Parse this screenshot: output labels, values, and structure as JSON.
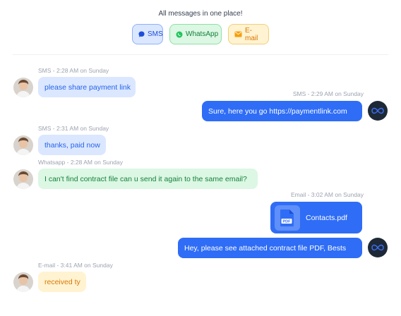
{
  "header": {
    "title": "All messages in one place!",
    "channels": [
      {
        "label": "SMS",
        "icon": "chat-bubble-icon",
        "color": "#1d4ed8"
      },
      {
        "label": "WhatsApp",
        "icon": "whatsapp-icon",
        "color": "#15803d"
      },
      {
        "label": "E-mail",
        "icon": "envelope-icon",
        "color": "#d97706"
      }
    ]
  },
  "messages": [
    {
      "direction": "incoming",
      "channel": "SMS",
      "meta": "SMS - 2:28 AM on Sunday",
      "text": "please share payment link"
    },
    {
      "direction": "outgoing",
      "channel": "SMS",
      "meta": "SMS - 2:29 AM on Sunday",
      "text": "Sure, here you go https://paymentlink.com"
    },
    {
      "direction": "incoming",
      "channel": "SMS",
      "meta": "SMS - 2:31 AM on Sunday",
      "text": "thanks, paid now"
    },
    {
      "direction": "incoming",
      "channel": "Whatsapp",
      "meta": "Whatsapp - 2:28 AM on Sunday",
      "text": "I can't find contract file can u send it again to the same email?"
    },
    {
      "direction": "outgoing",
      "channel": "Email",
      "meta": "Email - 3:02 AM on Sunday",
      "attachment": {
        "name": "Contacts.pdf",
        "icon": "pdf-file-icon",
        "icon_label": "PDF"
      }
    },
    {
      "direction": "outgoing",
      "channel": "Email",
      "text": "Hey, please see attached contract file PDF, Bests"
    },
    {
      "direction": "incoming",
      "channel": "E-mail",
      "meta": "E-mail - 3:41 AM on Sunday",
      "text": "received ty"
    }
  ],
  "colors": {
    "outgoing_bubble": "#2f6df6",
    "sms_bubble": "#dbe7ff",
    "whatsapp_bubble": "#dcf7e3",
    "email_bubble": "#fff3d1",
    "agent_avatar": "#1e2937"
  }
}
